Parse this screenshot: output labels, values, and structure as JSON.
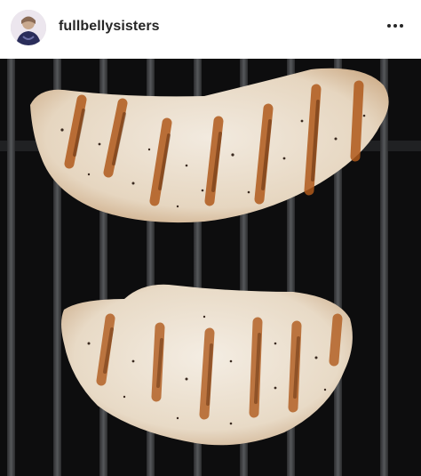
{
  "post": {
    "username": "fullbellysisters",
    "avatar_icon": "profile-avatar-icon",
    "more_icon": "more-options-icon"
  },
  "photo": {
    "subject_icon": "grilled-chicken-image"
  }
}
